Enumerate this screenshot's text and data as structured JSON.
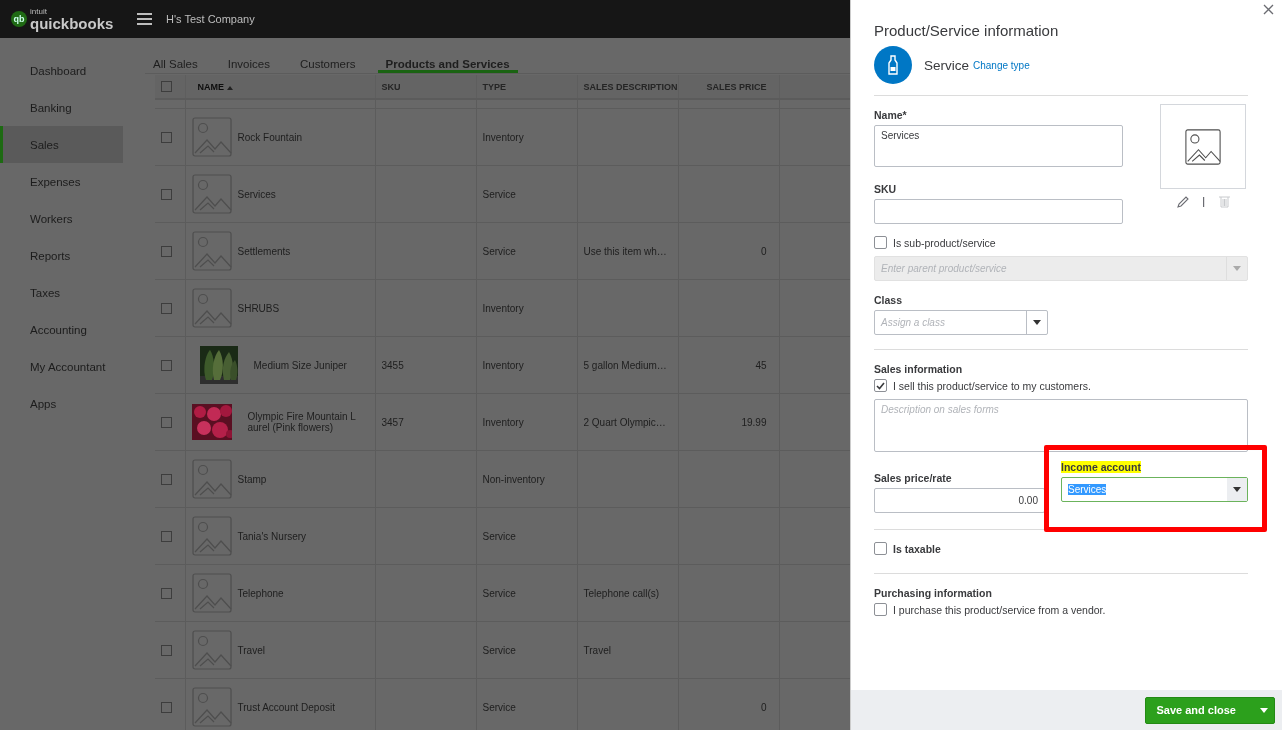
{
  "topbar": {
    "logo_mark": "qb",
    "logo_small": "intuit",
    "logo": "quickbooks",
    "company": "H's Test Company"
  },
  "sidebar": {
    "items": [
      {
        "label": "Dashboard",
        "selected": false
      },
      {
        "label": "Banking",
        "selected": false
      },
      {
        "label": "Sales",
        "selected": true
      },
      {
        "label": "Expenses",
        "selected": false
      },
      {
        "label": "Workers",
        "selected": false
      },
      {
        "label": "Reports",
        "selected": false
      },
      {
        "label": "Taxes",
        "selected": false
      },
      {
        "label": "Accounting",
        "selected": false
      },
      {
        "label": "My Accountant",
        "selected": false
      },
      {
        "label": "Apps",
        "selected": false
      }
    ]
  },
  "tabs": [
    {
      "label": "All Sales",
      "selected": false
    },
    {
      "label": "Invoices",
      "selected": false
    },
    {
      "label": "Customers",
      "selected": false
    },
    {
      "label": "Products and Services",
      "selected": true
    }
  ],
  "table": {
    "select_all_checked": false,
    "columns": [
      {
        "label": "NAME",
        "sorted": true
      },
      {
        "label": "SKU",
        "sorted": false
      },
      {
        "label": "TYPE",
        "sorted": false
      },
      {
        "label": "SALES DESCRIPTION",
        "sorted": false
      },
      {
        "label": "SALES PRICE",
        "sorted": false
      }
    ],
    "rows": [
      {
        "checked": false,
        "kind": "placeholder",
        "name": "Rock Fountain",
        "type": "Inventory"
      },
      {
        "checked": false,
        "kind": "placeholder",
        "name": "Services",
        "type": "Service"
      },
      {
        "checked": false,
        "kind": "placeholder",
        "name": "Settlements",
        "type": "Service",
        "description": "Use this item wh…",
        "price": "0"
      },
      {
        "checked": false,
        "kind": "placeholder",
        "name": "SHRUBS",
        "type": "Inventory"
      },
      {
        "checked": false,
        "kind": "picture",
        "name": "Medium Size Juniper",
        "sku": "3455",
        "type": "Inventory",
        "description": "5 gallon Medium…",
        "price": "45"
      },
      {
        "checked": false,
        "kind": "picture",
        "name": "Olympic Fire Mountain Laurel (Pink flowers)",
        "sku": "3457",
        "type": "Inventory",
        "description": "2 Quart Olympic…",
        "price": "19.99"
      },
      {
        "checked": false,
        "kind": "placeholder",
        "name": "Stamp",
        "type": "Non-inventory"
      },
      {
        "checked": false,
        "kind": "placeholder",
        "name": "Tania's Nursery",
        "type": "Service"
      },
      {
        "checked": false,
        "kind": "placeholder",
        "name": "Telephone",
        "type": "Service",
        "description": "Telephone call(s)"
      },
      {
        "checked": false,
        "kind": "placeholder",
        "name": "Travel",
        "type": "Service",
        "description": "Travel"
      },
      {
        "checked": false,
        "kind": "placeholder",
        "name": "Trust Account Deposit",
        "type": "Service",
        "price": "0"
      }
    ]
  },
  "panel": {
    "title": "Product/Service information",
    "type_label": "Service",
    "change_type": "Change type",
    "name": {
      "label": "Name*",
      "value": "Services"
    },
    "sku": {
      "label": "SKU"
    },
    "sub_product": {
      "label": "Is sub-product/service",
      "checked": false
    },
    "parent": {
      "placeholder": "Enter parent product/service",
      "disabled": true
    },
    "class": {
      "label": "Class",
      "placeholder": "Assign a class"
    },
    "sales": {
      "heading": "Sales information",
      "sell": {
        "label": "I sell this product/service to my customers.",
        "checked": true
      },
      "description": {
        "placeholder": "Description on sales forms"
      },
      "price": {
        "label": "Sales price/rate",
        "value": "0.00"
      },
      "income": {
        "label": "Income account",
        "value": "Services",
        "label_highlighted": true,
        "value_selected": true,
        "annotated": true
      }
    },
    "taxable": {
      "label": "Is taxable",
      "checked": false
    },
    "purchasing": {
      "heading": "Purchasing information",
      "purchase": {
        "label": "I purchase this product/service from a vendor.",
        "checked": false
      }
    },
    "save_button": "Save and close"
  }
}
